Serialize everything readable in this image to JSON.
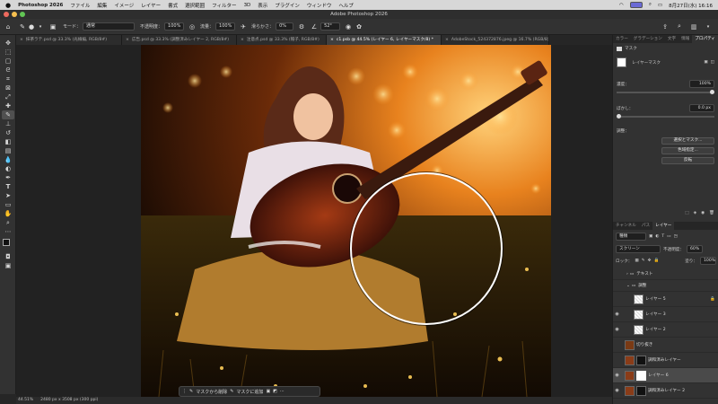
{
  "menubar": {
    "app": "Photoshop 2026",
    "items": [
      "ファイル",
      "編集",
      "イメージ",
      "レイヤー",
      "書式",
      "選択範囲",
      "フィルター",
      "3D",
      "表示",
      "プラグイン",
      "ウィンドウ",
      "ヘルプ"
    ],
    "clock": "8月27日(水) 16:16"
  },
  "window": {
    "title": "Adobe Photoshop 2026"
  },
  "options": {
    "mode_label": "モード：",
    "mode_value": "通常",
    "opacity_label": "不透明度：",
    "opacity_value": "100%",
    "flow_label": "流量：",
    "flow_value": "100%",
    "smoothing_label": "滑らかさ：",
    "smoothing_value": "0%",
    "angle_value": "52°"
  },
  "tabs": [
    {
      "label": "抹茶ラテ.psd @ 33.3% (光線編, RGB/8#)",
      "close": "×",
      "active": false
    },
    {
      "label": "広告.psd @ 33.3% (調整済みレイヤー 2, RGB/8#)",
      "close": "×",
      "active": false
    },
    {
      "label": "注意点.psd @ 33.3% (帽子, RGB/8#)",
      "close": "×",
      "active": false
    },
    {
      "label": "c1.psb @ 44.5% (レイヤー 6, レイヤーマスク/8) *",
      "close": "×",
      "active": true
    },
    {
      "label": "AdobeStock_524372876.jpeg @ 16.7% (RGB/8)",
      "close": "×",
      "active": false
    }
  ],
  "context_bar": {
    "remove_label": "マスクから削除",
    "add_label": "マスクに追加"
  },
  "status": {
    "zoom": "44.51%",
    "doc_info": "2480 px x 3508 px (300 ppi)"
  },
  "properties": {
    "tabs": [
      "カラー",
      "グラデーション",
      "文字",
      "情報",
      "プロパティ"
    ],
    "active_tab": "プロパティ",
    "section_label": "マスク",
    "mask_name": "レイヤーマスク",
    "density_label": "濃度：",
    "density_value": "100%",
    "feather_label": "ぼかし：",
    "feather_value": "0.0 px",
    "refine_label": "調整：",
    "select_mask_button": "選択とマスク...",
    "color_range_button": "色域指定...",
    "invert_button": "反転"
  },
  "layers": {
    "tabs": [
      "チャンネル",
      "パス",
      "レイヤー"
    ],
    "active_tab": "レイヤー",
    "search_value": "種類",
    "blend_mode": "スクリーン",
    "opacity_label": "不透明度：",
    "opacity_value": "60%",
    "lock_label": "ロック：",
    "fill_label": "塗り：",
    "fill_value": "100%",
    "items": [
      {
        "name": "テキスト",
        "kind": "group",
        "visible": false,
        "selected": false,
        "indent": 0
      },
      {
        "name": "調整",
        "kind": "group",
        "visible": false,
        "selected": false,
        "indent": 0
      },
      {
        "name": "レイヤー 5",
        "kind": "layer",
        "visible": false,
        "selected": false,
        "indent": 1,
        "locked": true
      },
      {
        "name": "レイヤー 3",
        "kind": "layer",
        "visible": true,
        "selected": false,
        "indent": 1
      },
      {
        "name": "レイヤー 2",
        "kind": "layer",
        "visible": true,
        "selected": false,
        "indent": 1
      },
      {
        "name": "切り抜き",
        "kind": "photo",
        "visible": false,
        "selected": false,
        "indent": 0
      },
      {
        "name": "調和済みレイヤー",
        "kind": "masked",
        "visible": false,
        "selected": false,
        "indent": 0
      },
      {
        "name": "レイヤー 6",
        "kind": "masked",
        "visible": true,
        "selected": true,
        "indent": 0
      },
      {
        "name": "調和済みレイヤー 2",
        "kind": "masked",
        "visible": true,
        "selected": false,
        "indent": 0
      }
    ]
  },
  "colors": {
    "accent": "#3a7bd5",
    "canvas_glow": "#f2a23a",
    "panel_bg": "#323232"
  }
}
